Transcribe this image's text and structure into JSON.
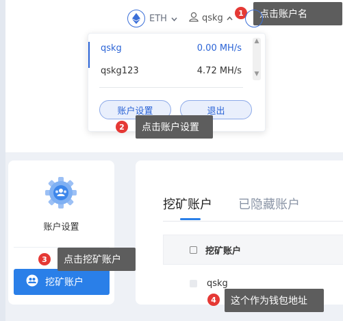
{
  "header": {
    "coin": "ETH",
    "username": "qskg"
  },
  "dropdown": {
    "accounts": [
      {
        "name": "qskg",
        "hashrate": "0.00 MH/s"
      },
      {
        "name": "qskg123",
        "hashrate": "4.72 MH/s"
      }
    ],
    "settings_button": "账户设置",
    "logout_button": "退出"
  },
  "sidebar": {
    "settings_label": "账户设置",
    "mining_account_button": "挖矿账户"
  },
  "main": {
    "tabs": [
      "挖矿账户",
      "已隐藏账户"
    ],
    "table_header": "挖矿账户",
    "rows": [
      "qskg"
    ]
  },
  "annotations": [
    {
      "number": "1",
      "text": "点击账户名"
    },
    {
      "number": "2",
      "text": "点击账户设置"
    },
    {
      "number": "3",
      "text": "点击挖矿账户"
    },
    {
      "number": "4",
      "text": "这个作为钱包地址"
    }
  ],
  "colors": {
    "accent": "#2a7fe8",
    "badge": "#e53935",
    "tooltip": "#5d5d5d"
  }
}
